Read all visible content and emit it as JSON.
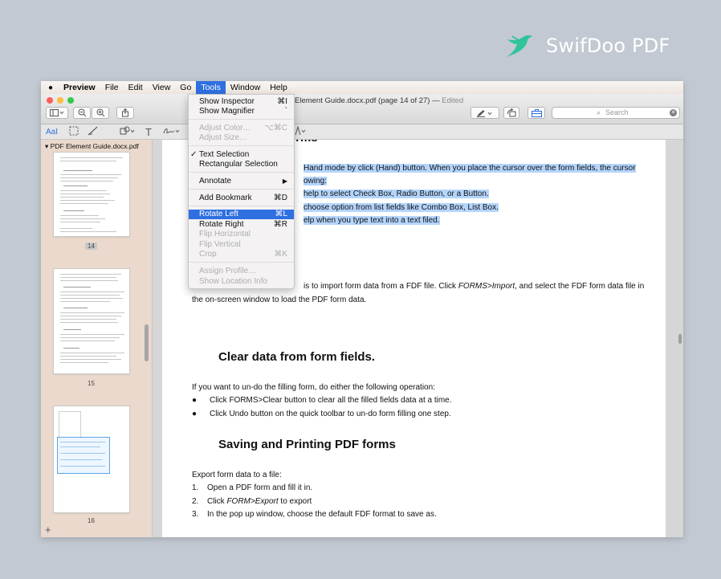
{
  "brand": {
    "name": "SwifDoo PDF",
    "color": "#ffffff",
    "icon_color": "#2fc49a"
  },
  "menubar": {
    "app_name": "Preview",
    "items": [
      "File",
      "Edit",
      "View",
      "Go",
      "Tools",
      "Window",
      "Help"
    ],
    "active": "Tools",
    "accent": "#2f6fe0"
  },
  "window": {
    "title": "Element Guide.docx.pdf (page 14 of 27)",
    "separator": "—",
    "edited": "Edited",
    "search_placeholder": "Search"
  },
  "markup_bar": {
    "text_style": "AaI",
    "text_tool": "T"
  },
  "sidebar": {
    "doc_name": "PDF Element Guide.docx.pdf",
    "pages": [
      {
        "number": "14"
      },
      {
        "number": "15"
      },
      {
        "number": "16"
      }
    ],
    "add": "+"
  },
  "tools_menu": {
    "show_inspector": {
      "label": "Show Inspector",
      "shortcut": "⌘I"
    },
    "show_magnifier": {
      "label": "Show Magnifier",
      "shortcut": "`"
    },
    "adjust_color": {
      "label": "Adjust Color…",
      "shortcut": "⌥⌘C"
    },
    "adjust_size": {
      "label": "Adjust Size…"
    },
    "text_selection": {
      "label": "Text Selection",
      "check": "✓"
    },
    "rectangular_selection": {
      "label": "Rectangular Selection"
    },
    "annotate": {
      "label": "Annotate",
      "submenu": "▶"
    },
    "add_bookmark": {
      "label": "Add Bookmark",
      "shortcut": "⌘D"
    },
    "rotate_left": {
      "label": "Rotate Left",
      "shortcut": "⌘L"
    },
    "rotate_right": {
      "label": "Rotate Right",
      "shortcut": "⌘R"
    },
    "flip_horizontal": {
      "label": "Flip Horizontal"
    },
    "flip_vertical": {
      "label": "Flip Vertical"
    },
    "crop": {
      "label": "Crop",
      "shortcut": "⌘K"
    },
    "assign_profile": {
      "label": "Assign Profile…"
    },
    "show_location_info": {
      "label": "Show Location Info"
    }
  },
  "document": {
    "heading_partial": "forms",
    "hl1": "Hand mode by click (Hand) button. When you place the cursor over the form fields, the cursor",
    "hl2": "owing:",
    "hl3": "help to select Check Box, Radio Button, or a Button.",
    "hl4": "choose option from list fields like Combo Box, List Box.",
    "hl5": "elp when you type text into a text filed.",
    "import_line1_a": "is to import form data from a FDF file. Click ",
    "import_line1_b": "FORMS>Import",
    "import_line1_c": ", and select the FDF form data file in",
    "import_line2": "the on-screen window to load the PDF form data.",
    "clear_heading": "Clear data from form fields.",
    "clear_intro": "If you want to un-do the filling form, do either the following operation:",
    "bullet": "●",
    "bullet1": "Click FORMS>Clear button to clear all the filled fields data at a time.",
    "bullet2": "Click Undo button on the quick toolbar to un-do form filling one step.",
    "save_heading": "Saving and Printing PDF forms",
    "export_intro": "Export form data to a file:",
    "step1_num": "1.",
    "step1": "Open a PDF form and fill it in.",
    "step2_num": "2.",
    "step2_a": "Click ",
    "step2_b": "FORM>Export",
    "step2_c": " to export",
    "step3_num": "3.",
    "step3": "In the pop up window, choose the default FDF format to save as.",
    "highlight_color": "#b4d5fd"
  }
}
